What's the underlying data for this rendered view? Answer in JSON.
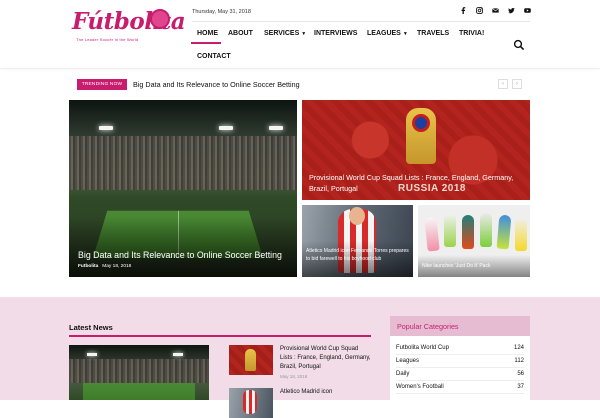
{
  "brand": {
    "name": "Fútbolita",
    "tagline": "The Leader Soccer in the World",
    "accent": "#c81d6e"
  },
  "header": {
    "date": "Thursday, May 31, 2018",
    "socials": [
      "facebook-icon",
      "instagram-icon",
      "mail-icon",
      "twitter-icon",
      "youtube-icon"
    ]
  },
  "nav": {
    "items": [
      {
        "label": "HOME",
        "active": true,
        "dropdown": false
      },
      {
        "label": "ABOUT",
        "active": false,
        "dropdown": false
      },
      {
        "label": "SERVICES",
        "active": false,
        "dropdown": true
      },
      {
        "label": "INTERVIEWS",
        "active": false,
        "dropdown": false
      },
      {
        "label": "LEAGUES",
        "active": false,
        "dropdown": true
      },
      {
        "label": "TRAVELS",
        "active": false,
        "dropdown": false
      },
      {
        "label": "TRIVIA!",
        "active": false,
        "dropdown": false
      },
      {
        "label": "CONTACT",
        "active": false,
        "dropdown": false
      }
    ]
  },
  "trending": {
    "badge": "TRENDING NOW",
    "headline": "Big Data and Its Relevance to Online Soccer Betting",
    "prev": "‹",
    "next": "›"
  },
  "featured": {
    "main": {
      "title": "Big Data and Its Relevance to Online Soccer Betting",
      "author": "Futbolita",
      "date": "May 18, 2018"
    },
    "wc": {
      "title": "Provisional World Cup Squad Lists : France, England, Germany, Brazil, Portugal",
      "overlay_text": "RUSSIA 2018"
    },
    "small1": {
      "title": "Atletico Madrid icon Fernando Torres prepares to bid farewell to his boyhood club"
    },
    "small2": {
      "title": "Nike launches ‘Just Do It’ Pack"
    }
  },
  "latest": {
    "heading": "Latest News",
    "items": [
      {
        "title": "Provisional World Cup Squad Lists : France, England, Germany, Brazil, Portugal",
        "date": "May 18, 2018"
      },
      {
        "title": "Atletico Madrid icon",
        "date": ""
      }
    ]
  },
  "categories": {
    "heading": "Popular Categories",
    "items": [
      {
        "name": "Futbolita World Cup",
        "count": "124"
      },
      {
        "name": "Leagues",
        "count": "112"
      },
      {
        "name": "Daily",
        "count": "56"
      },
      {
        "name": "Women's Football",
        "count": "37"
      }
    ]
  }
}
